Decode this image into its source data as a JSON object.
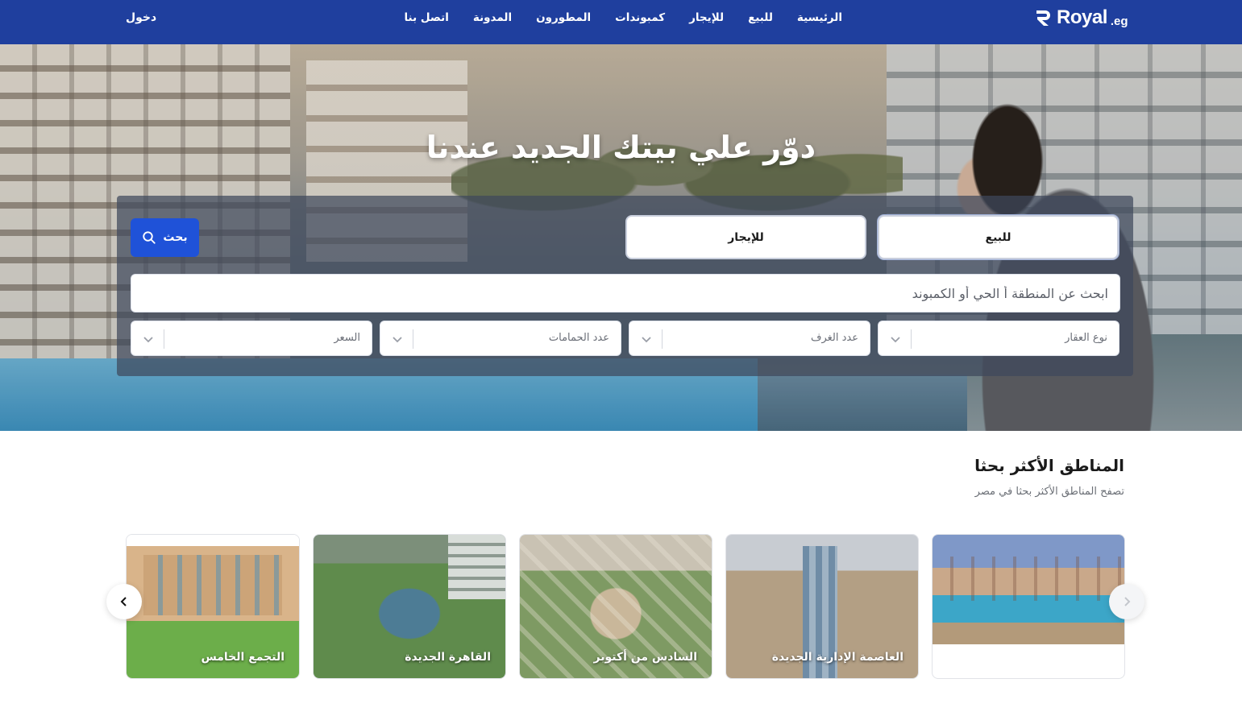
{
  "nav": {
    "login": "دخول",
    "items": [
      "الرئيسية",
      "للبيع",
      "للإيجار",
      "كمبوندات",
      "المطورون",
      "المدونة",
      "اتصل بنا"
    ],
    "logo": {
      "brand": "Royal",
      "tld": ".eg",
      "icon": "royal-r-logo-icon"
    },
    "background": "#1f3f9e"
  },
  "hero": {
    "title": "دوّر علي بيتك الجديد عندنا",
    "tabs": {
      "sale": "للبيع",
      "rent": "للإيجار"
    },
    "search_button": "بحث",
    "search_placeholder": "ابحث عن المنطقة أ الحي أو الكمبوند",
    "filters": {
      "property_type": "نوع العقار",
      "rooms": "عدد الغرف",
      "bathrooms": "عدد الحمامات",
      "price": "السعر"
    },
    "accent": "#1f52d8"
  },
  "areas": {
    "title": "المناطق الأكثر بحثا",
    "subtitle": "تصفح المناطق الأكثر بحثا في مصر",
    "cards": [
      {
        "name": ""
      },
      {
        "name": "العاصمة الإدارية الجديدة"
      },
      {
        "name": "السادس من أكتوبر"
      },
      {
        "name": "القاهرة الجديدة"
      },
      {
        "name": "التجمع الخامس"
      }
    ]
  }
}
